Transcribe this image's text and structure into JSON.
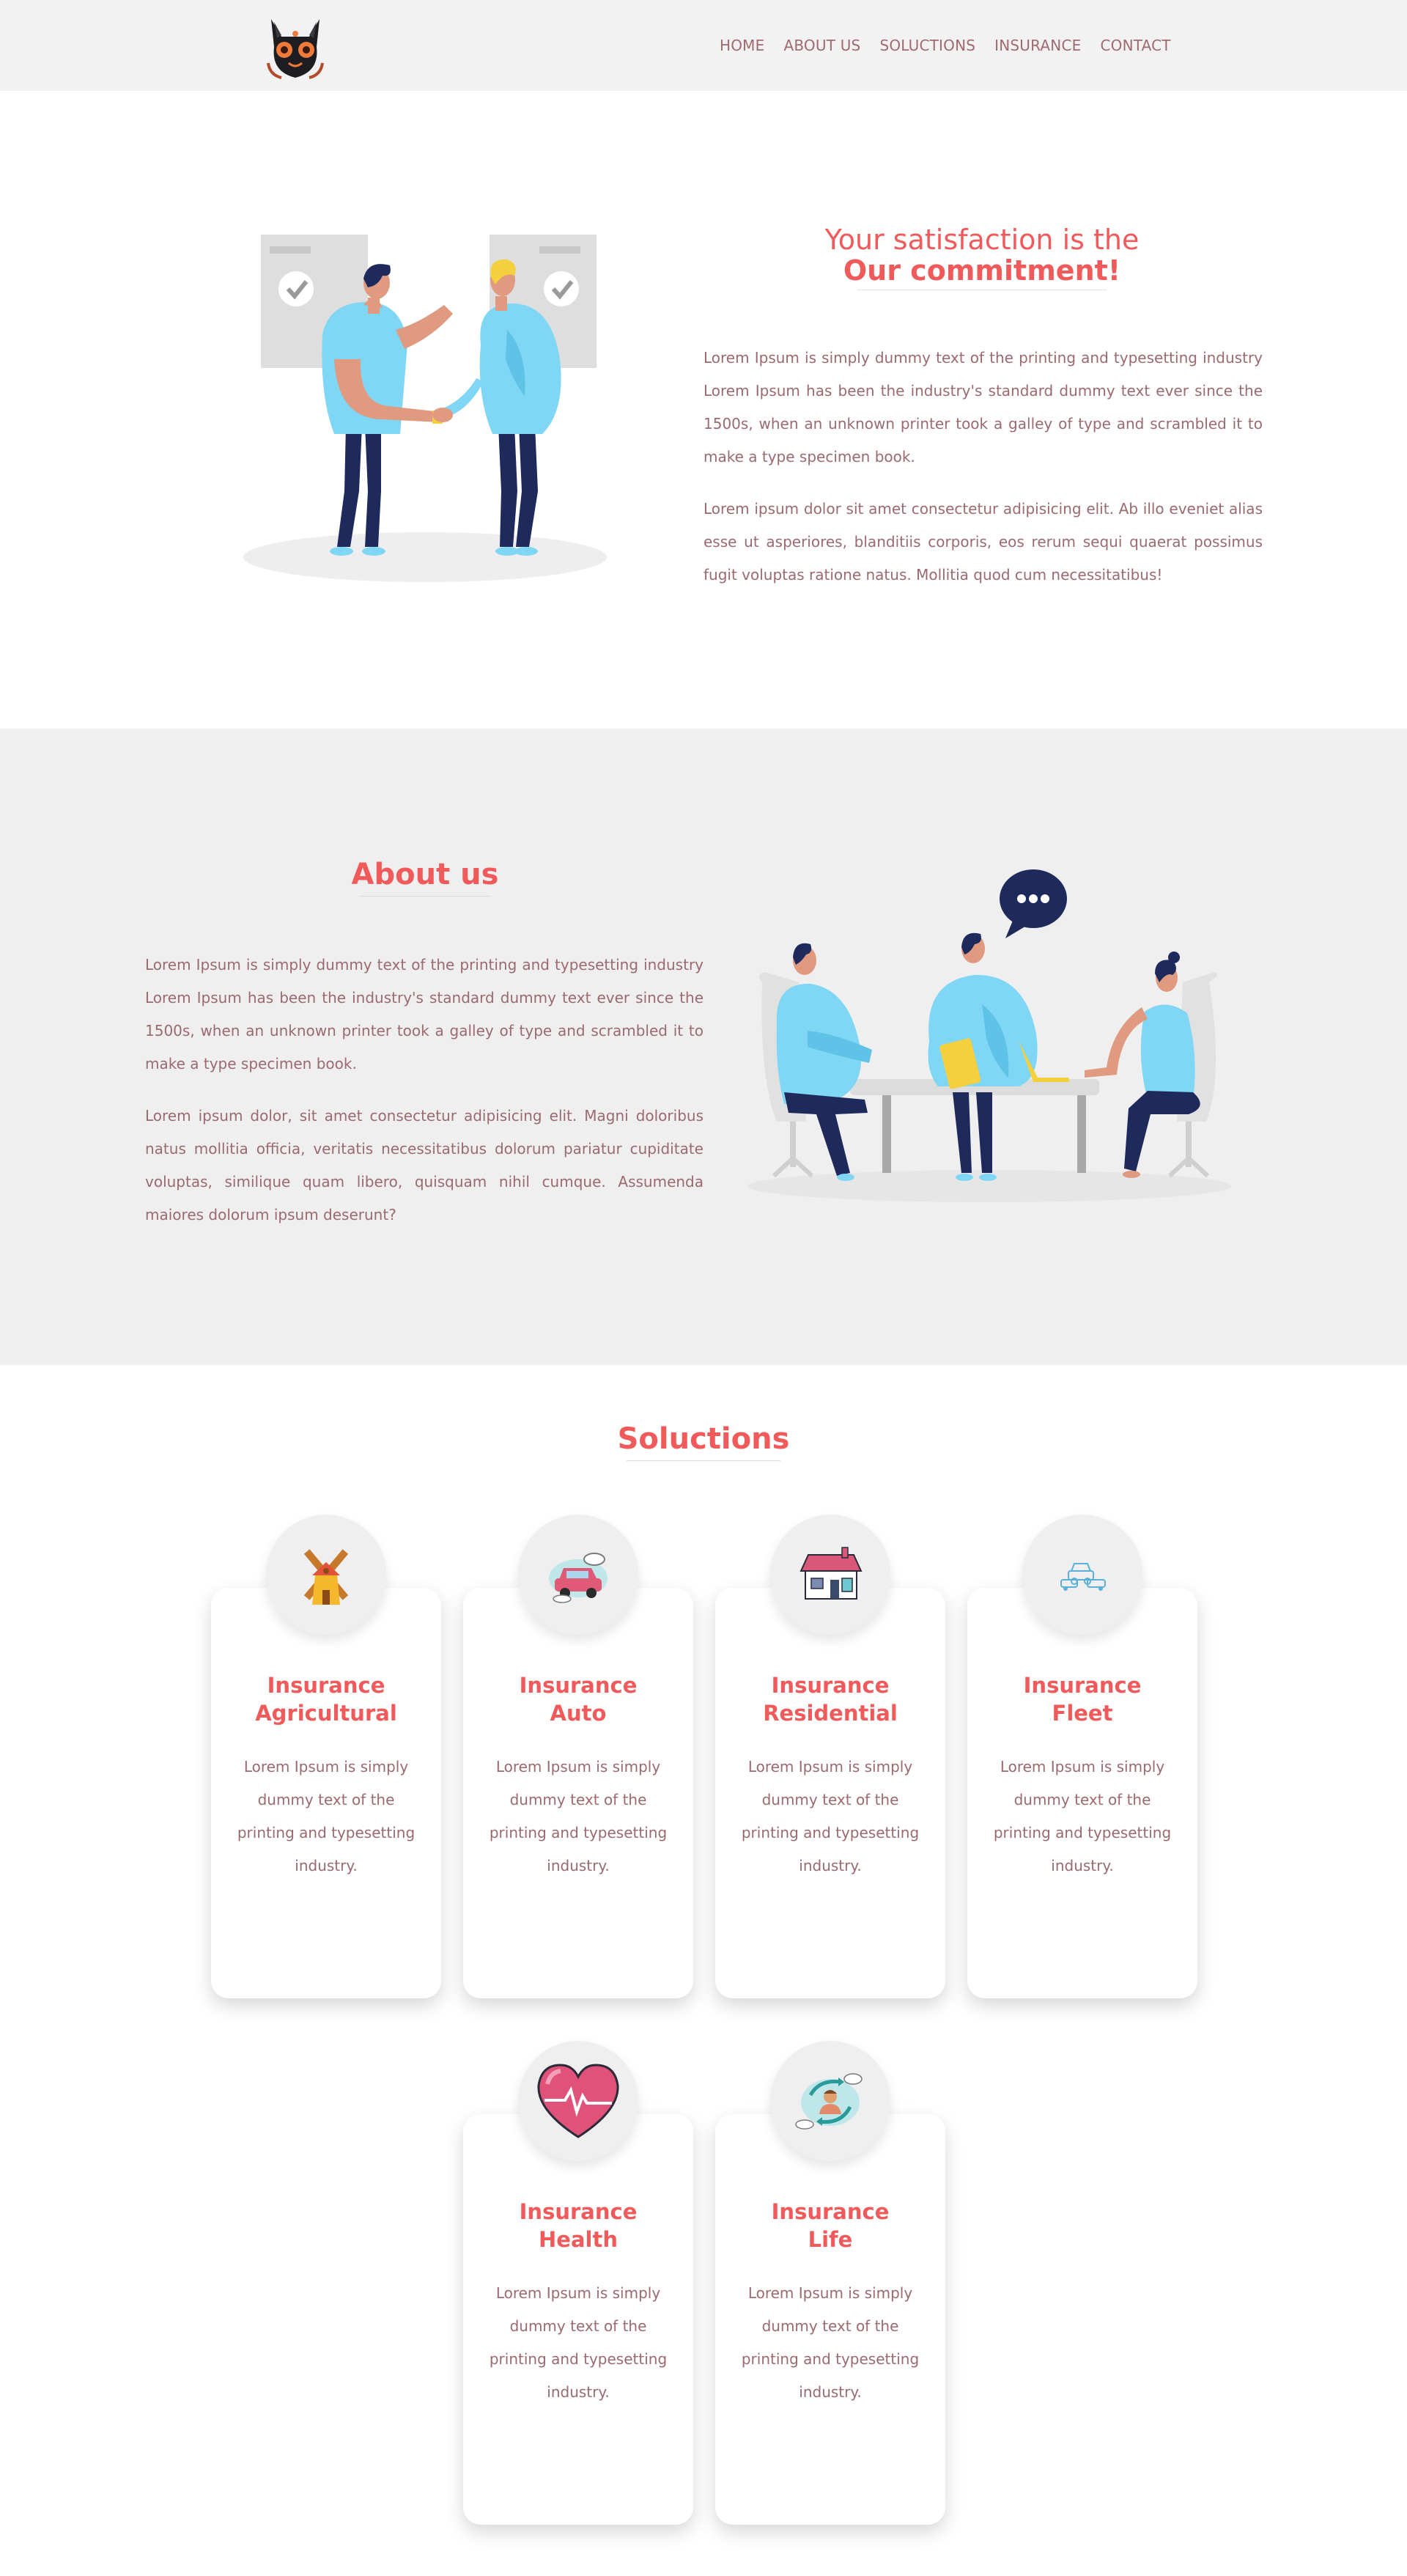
{
  "header": {
    "logo_icon": "black-cat-head-logo",
    "nav": [
      "HOME",
      "ABOUT US",
      "SOLUCTIONS",
      "INSURANCE",
      "CONTACT"
    ]
  },
  "commitment": {
    "title_line1": "Your satisfaction is the",
    "title_line2": "Our commitment!",
    "paragraph1": "Lorem Ipsum is simply dummy text of the printing and typesetting industry Lorem Ipsum has been the industry's standard dummy text ever since the 1500s, when an unknown printer took a galley of type and scrambled it to make a type specimen book.",
    "paragraph2": "Lorem ipsum dolor sit amet consectetur adipisicing elit. Ab illo eveniet alias esse ut asperiores, blanditiis corporis, eos rerum sequi quaerat possimus fugit voluptas ratione natus. Mollitia quod cum necessitatibus!",
    "illustration": "handshake-illustration"
  },
  "about": {
    "title": "About us",
    "paragraph1": "Lorem Ipsum is simply dummy text of the printing and typesetting industry Lorem Ipsum has been the industry's standard dummy text ever since the 1500s, when an unknown printer took a galley of type and scrambled it to make a type specimen book.",
    "paragraph2": "Lorem ipsum dolor, sit amet consectetur adipisicing elit. Magni doloribus natus mollitia officia, veritatis necessitatibus dolorum pariatur cupiditate voluptas, similique quam libero, quisquam nihil cumque. Assumenda maiores dolorum ipsum deserunt?",
    "illustration": "team-meeting-illustration"
  },
  "solutions": {
    "title": "Soluctions",
    "cards": [
      {
        "line1": "Insurance",
        "line2": "Agricultural",
        "text": "Lorem Ipsum is simply dummy text of the printing and typesetting industry.",
        "icon": "windmill-icon"
      },
      {
        "line1": "Insurance",
        "line2": "Auto",
        "text": "Lorem Ipsum is simply dummy text of the printing and typesetting industry.",
        "icon": "car-icon"
      },
      {
        "line1": "Insurance",
        "line2": "Residential",
        "text": "Lorem Ipsum is simply dummy text of the printing and typesetting industry.",
        "icon": "house-icon"
      },
      {
        "line1": "Insurance",
        "line2": "Fleet",
        "text": "Lorem Ipsum is simply dummy text of the printing and typesetting industry.",
        "icon": "fleet-cars-icon"
      },
      {
        "line1": "Insurance",
        "line2": "Health",
        "text": "Lorem Ipsum is simply dummy text of the printing and typesetting industry.",
        "icon": "heart-pulse-icon"
      },
      {
        "line1": "Insurance",
        "line2": "Life",
        "text": "Lorem Ipsum is simply dummy text of the printing and typesetting industry.",
        "icon": "person-cycle-icon"
      }
    ]
  },
  "colors": {
    "accent": "#f05a5a",
    "text": "#9a6a70",
    "header_bg": "#f2f2f2",
    "section_bg": "#f0efef",
    "figure_blue": "#7fd6f5",
    "figure_navy": "#1f2a5c"
  }
}
